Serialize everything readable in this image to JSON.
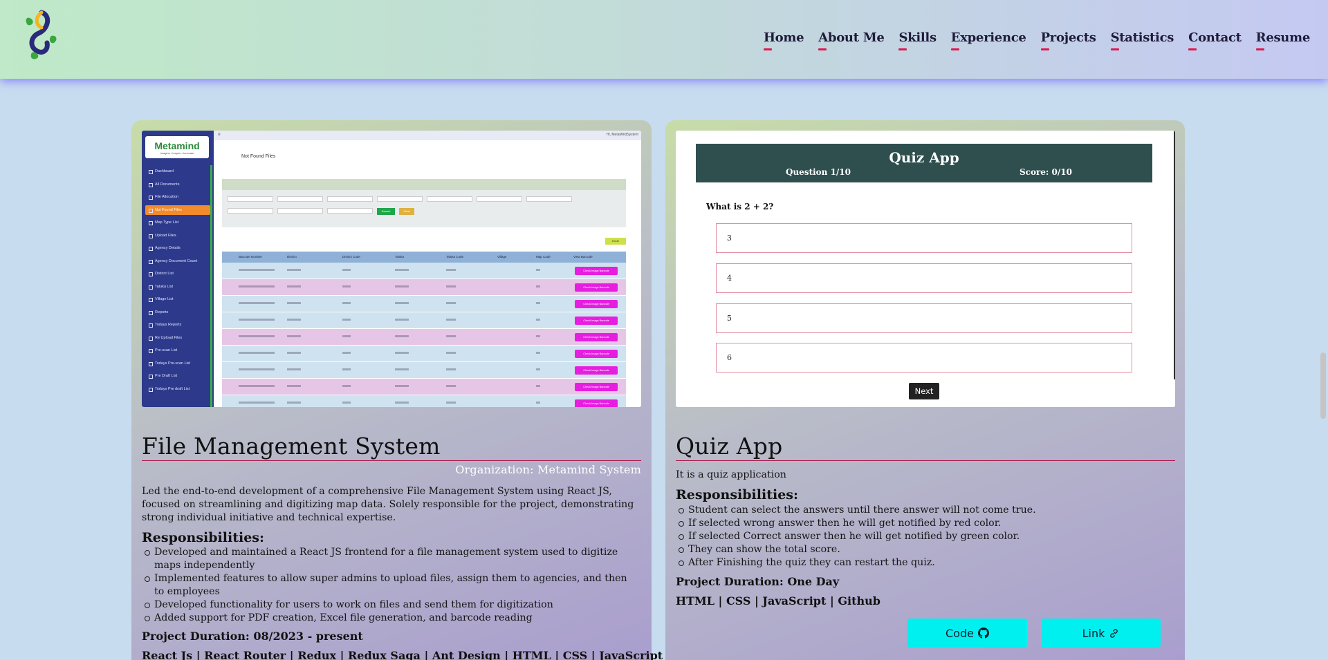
{
  "header": {
    "nav": [
      "Home",
      "About Me",
      "Skills",
      "Experience",
      "Projects",
      "Statistics",
      "Contact",
      "Resume"
    ]
  },
  "projects": [
    {
      "title": "File Management System",
      "organization": "Organization: Metamind System",
      "description": "Led the end-to-end development of a comprehensive File Management System using React JS, focused on streamlining and digitizing map data. Solely responsible for the project, demonstrating strong individual initiative and technical expertise.",
      "responsibilities_heading": "Responsibilities:",
      "responsibilities": [
        "Developed and maintained a React JS frontend for a file management system used to digitize maps independently",
        "Implemented features to allow super admins to upload files, assign them to agencies, and then to employees",
        "Developed functionality for users to work on files and send them for digitization",
        "Added support for PDF creation, Excel file generation, and barcode reading"
      ],
      "duration": "Project Duration: 08/2023 - present",
      "tech": "React Js | React Router | Redux | Redux Saga | Ant Design | HTML | CSS | JavaScript | NPM |",
      "screenshot": {
        "brand": "Metamind",
        "brand_tagline": "Imagine • Inspire • Innovate",
        "page_heading": "Not Found Files",
        "topbar_right": "Hi, MetaMindSystem",
        "sidebar_items": [
          "Dashboard",
          "All Documents",
          "File Allocation",
          "Not Found Files",
          "Map Type List",
          "Upload Files",
          "Agency Details",
          "Agency Document Count",
          "District List",
          "Taluka List",
          "Village List",
          "Reports",
          "Todays Reports",
          "Re Upload Files",
          "Pre-scan List",
          "Todays Pre-scan List",
          "Pre Draft List",
          "Todays Pre draft List"
        ],
        "active_item": "Not Found Files",
        "table_headers": [
          "Barcode Number",
          "District",
          "District Code",
          "Taluka",
          "Taluka Code",
          "Village",
          "Map Code",
          "View Barcode"
        ],
        "row_button": "Check Image Barcode",
        "search_label": "Search",
        "clear_label": "Clear",
        "export_label": "Excel"
      }
    },
    {
      "title": "Quiz App",
      "description": "It is a quiz application",
      "responsibilities_heading": "Responsibilities:",
      "responsibilities": [
        "Student can select the answers until there answer will not come true.",
        "If selected wrong answer then he will get notified by red color.",
        "If selected Correct answer then he will get notified by green color.",
        "They can show the total score.",
        "After Finishing the quiz they can restart the quiz."
      ],
      "duration": "Project Duration: One Day",
      "tech": "HTML | CSS | JavaScript | Github",
      "buttons": {
        "code": "Code",
        "link": "Link"
      },
      "screenshot": {
        "title": "Quiz App",
        "question_counter": "Question 1/10",
        "score": "Score: 0/10",
        "question": "What is 2 + 2?",
        "options": [
          "3",
          "4",
          "5",
          "6"
        ],
        "next_label": "Next"
      }
    }
  ],
  "colors": {
    "accent": "#e0164d",
    "button": "#00f0f0",
    "quiz_header": "#2f4f4f",
    "sidebar": "#2d3a8c"
  }
}
